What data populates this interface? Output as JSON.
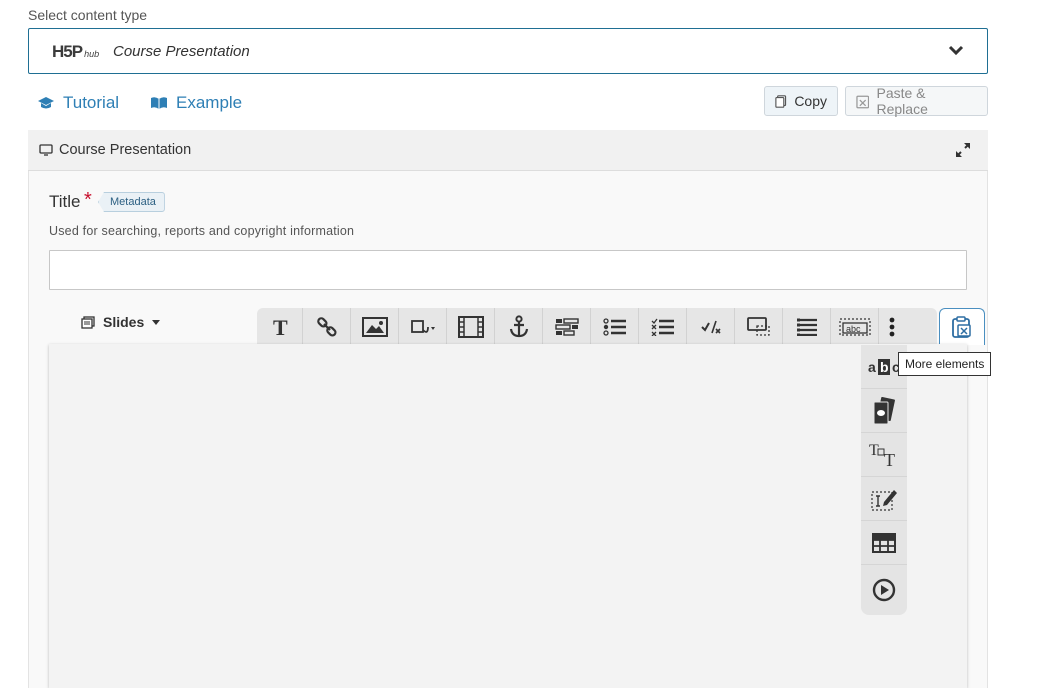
{
  "header": {
    "select_label": "Select content type",
    "hub_logo": "H5P",
    "hub_logo_suffix": "hub",
    "content_type": "Course Presentation"
  },
  "links": {
    "tutorial": "Tutorial",
    "example": "Example"
  },
  "actions": {
    "copy": "Copy",
    "paste_replace": "Paste & Replace"
  },
  "panel": {
    "title": "Course Presentation"
  },
  "form": {
    "title_label": "Title",
    "required_mark": "*",
    "metadata_badge": "Metadata",
    "title_description": "Used for searching, reports and copyright information",
    "title_value": ""
  },
  "editor": {
    "slides_menu": "Slides",
    "toolbar_items": [
      "text-icon",
      "link-icon",
      "image-icon",
      "shapes-icon",
      "video-icon",
      "anchor-icon",
      "fill-blanks-icon",
      "single-choice-icon",
      "multi-choice-icon",
      "true-false-icon",
      "drag-drop-icon",
      "summary-icon",
      "drag-text-icon",
      "more-elements-icon"
    ],
    "tooltip": "More elements",
    "dropdown_items": [
      "mark-words-icon",
      "dialog-cards-icon",
      "text-resize-icon",
      "essay-icon",
      "table-icon",
      "interactive-video-icon"
    ]
  },
  "colors": {
    "accent": "#2e7fb5",
    "select_border": "#1f6f93",
    "required": "#c8102e"
  }
}
